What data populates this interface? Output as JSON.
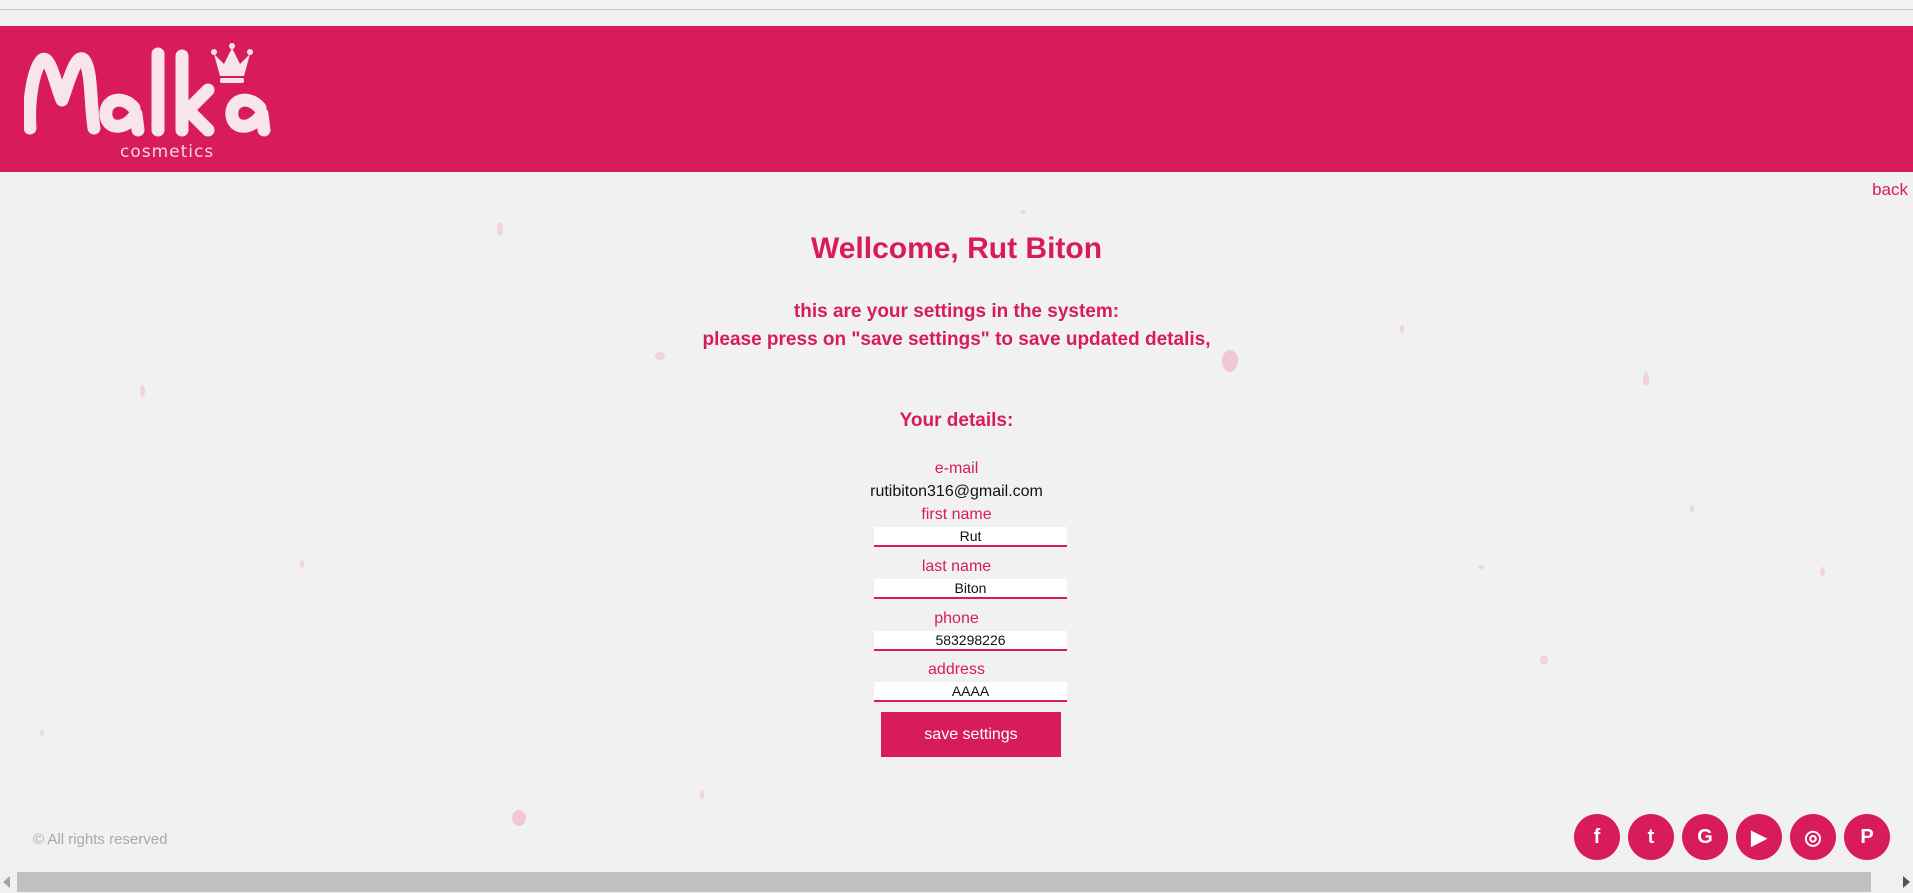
{
  "header": {
    "logo_text": "cosmetics",
    "back_label": "back",
    "brand_color": "#d81b5c"
  },
  "main": {
    "welcome": "Wellcome, Rut Biton",
    "instructions_line1": "this are your settings in the system:",
    "instructions_line2": "please press on \"save settings\" to save updated detalis,",
    "details_heading": "Your details:",
    "email": {
      "label": "e-mail",
      "value": "rutibiton316@gmail.com"
    },
    "first_name": {
      "label": "first name",
      "value": "Rut"
    },
    "last_name": {
      "label": "last name",
      "value": "Biton"
    },
    "phone": {
      "label": "phone",
      "value": "583298226"
    },
    "address": {
      "label": "address",
      "value": "AAAA"
    },
    "save_label": "save settings"
  },
  "footer": {
    "copyright": "© All rights reserved",
    "social": [
      {
        "icon": "facebook-icon",
        "glyph": "f"
      },
      {
        "icon": "twitter-icon",
        "glyph": "t"
      },
      {
        "icon": "google-icon",
        "glyph": "G"
      },
      {
        "icon": "youtube-icon",
        "glyph": "▶"
      },
      {
        "icon": "instagram-icon",
        "glyph": "◎"
      },
      {
        "icon": "pinterest-icon",
        "glyph": "P"
      }
    ]
  }
}
